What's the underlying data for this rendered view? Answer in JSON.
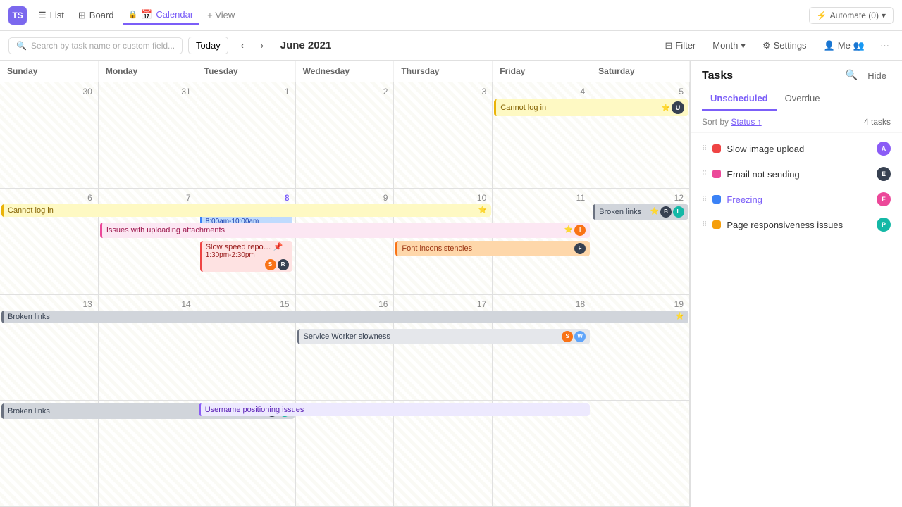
{
  "app": {
    "workspace_initials": "TS",
    "nav": {
      "list_label": "List",
      "board_label": "Board",
      "calendar_label": "Calendar",
      "view_label": "+ View"
    },
    "automate_label": "Automate (0)"
  },
  "toolbar": {
    "search_placeholder": "Search by task name or custom field...",
    "today_label": "Today",
    "month_title": "June 2021",
    "filter_label": "Filter",
    "month_label": "Month",
    "settings_label": "Settings",
    "me_label": "Me",
    "more_label": "···"
  },
  "calendar": {
    "day_headers": [
      "Sunday",
      "Monday",
      "Tuesday",
      "Wednesday",
      "Thursday",
      "Friday",
      "Saturday"
    ],
    "weeks": [
      {
        "dates": [
          "",
          "",
          "1",
          "2",
          "3",
          "4",
          "5"
        ],
        "date_nums": [
          null,
          null,
          1,
          2,
          3,
          4,
          5
        ]
      },
      {
        "dates": [
          "6",
          "7",
          "8",
          "9",
          "10",
          "11",
          "12"
        ],
        "date_nums": [
          6,
          7,
          8,
          9,
          10,
          11,
          12
        ]
      },
      {
        "dates": [
          "13",
          "14",
          "15",
          "16",
          "17",
          "18",
          "19"
        ],
        "date_nums": [
          13,
          14,
          15,
          16,
          17,
          18,
          19
        ]
      }
    ],
    "prev_dates": [
      "30",
      "31"
    ]
  },
  "tasks_panel": {
    "title": "Tasks",
    "tabs": [
      {
        "label": "Unscheduled",
        "active": true
      },
      {
        "label": "Overdue",
        "active": false
      }
    ],
    "sort_label": "Sort by",
    "sort_field": "Status",
    "count_label": "4 tasks",
    "items": [
      {
        "name": "Slow image upload",
        "status_color": "dot-red",
        "avatar_color": "av-purple",
        "avatar_initials": "A"
      },
      {
        "name": "Email not sending",
        "status_color": "dot-pink",
        "avatar_color": "av-dark",
        "avatar_initials": "E"
      },
      {
        "name": "Freezing",
        "status_color": "dot-blue",
        "avatar_color": "av-pink",
        "avatar_initials": "F",
        "is_link": true
      },
      {
        "name": "Page responsiveness issues",
        "status_color": "dot-yellow",
        "avatar_color": "av-teal",
        "avatar_initials": "P"
      }
    ]
  }
}
